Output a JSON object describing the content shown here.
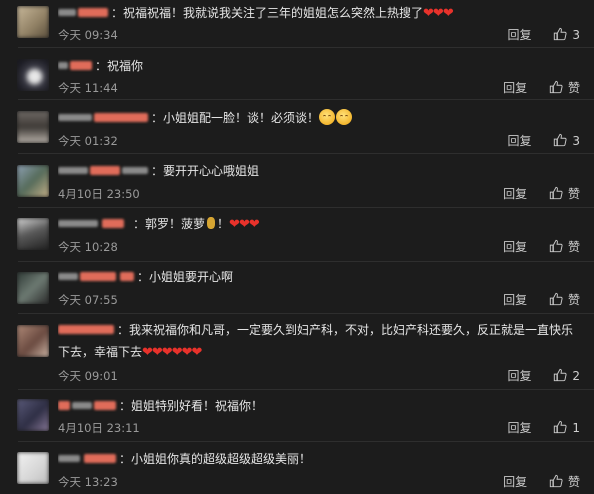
{
  "reply_label": "回复",
  "like_label": "赞",
  "comments": [
    {
      "text": "祝福祝福！我就说我关注了三年的姐姐怎么突然上热搜了",
      "hearts": "❤❤❤",
      "time": "今天 09:34",
      "likes": "3"
    },
    {
      "text": "祝福你",
      "time": "今天 11:44",
      "likes": "赞"
    },
    {
      "text": "小姐姐配一脸！谈！必须谈！",
      "emoji": "two-grinning-emoji",
      "time": "今天 01:32",
      "likes": "3"
    },
    {
      "text": "要开开心心哦姐姐",
      "time": "4月10日 23:50",
      "likes": "赞"
    },
    {
      "text": "郭罗！菠萝",
      "tail": "！",
      "hearts": "❤❤❤",
      "time": "今天 10:28",
      "likes": "赞"
    },
    {
      "text": "小姐姐要开心啊",
      "time": "今天 07:55",
      "likes": "赞"
    },
    {
      "text_line1": "我来祝福你和凡哥，一定要久到妇产科，不对，比妇产科还要久，反正就是一直快乐",
      "text_line2": "下去，幸福下去",
      "hearts": "❤❤❤❤❤❤",
      "time": "今天 09:01",
      "likes": "2"
    },
    {
      "text": "姐姐特别好看！祝福你！",
      "time": "4月10日 23:11",
      "likes": "1"
    },
    {
      "text": "小姐姐你真的超级超级超级美丽！",
      "time": "今天 13:23",
      "likes": "赞"
    }
  ],
  "colors": {
    "background": "#1c1c1c",
    "heart": "#e8322b",
    "meta": "#9a9a9a"
  }
}
